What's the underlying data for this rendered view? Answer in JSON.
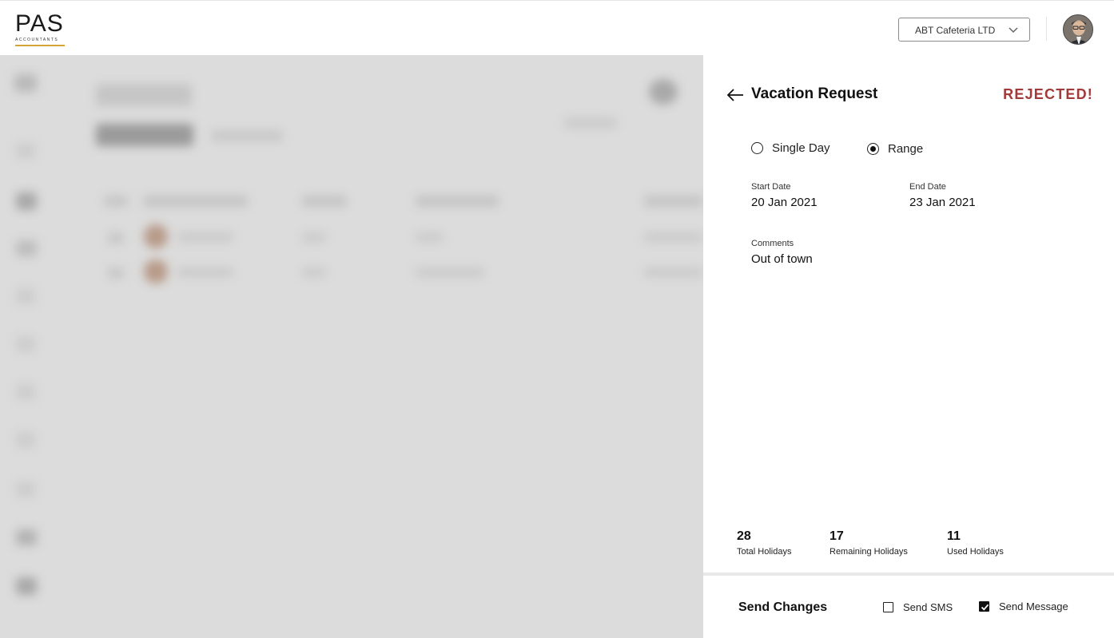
{
  "header": {
    "logo_text": "PAS",
    "logo_subtext": "ACCOUNTANTS",
    "company": "ABT Cafeteria LTD"
  },
  "panel": {
    "title": "Vacation Request",
    "status": "REJECTED!",
    "status_color": "#a33a3a",
    "options": [
      {
        "label": "Single Day",
        "selected": false
      },
      {
        "label": "Range",
        "selected": true
      }
    ],
    "start_date_label": "Start Date",
    "start_date": "20 Jan 2021",
    "end_date_label": "End Date",
    "end_date": "23 Jan 2021",
    "comments_label": "Comments",
    "comments": "Out of town",
    "stats": [
      {
        "value": "28",
        "label": "Total Holidays"
      },
      {
        "value": "17",
        "label": "Remaining Holidays"
      },
      {
        "value": "11",
        "label": "Used Holidays"
      }
    ],
    "send_title": "Send Changes",
    "send_sms_label": "Send SMS",
    "send_sms_checked": false,
    "send_message_label": "Send Message",
    "send_message_checked": true
  }
}
